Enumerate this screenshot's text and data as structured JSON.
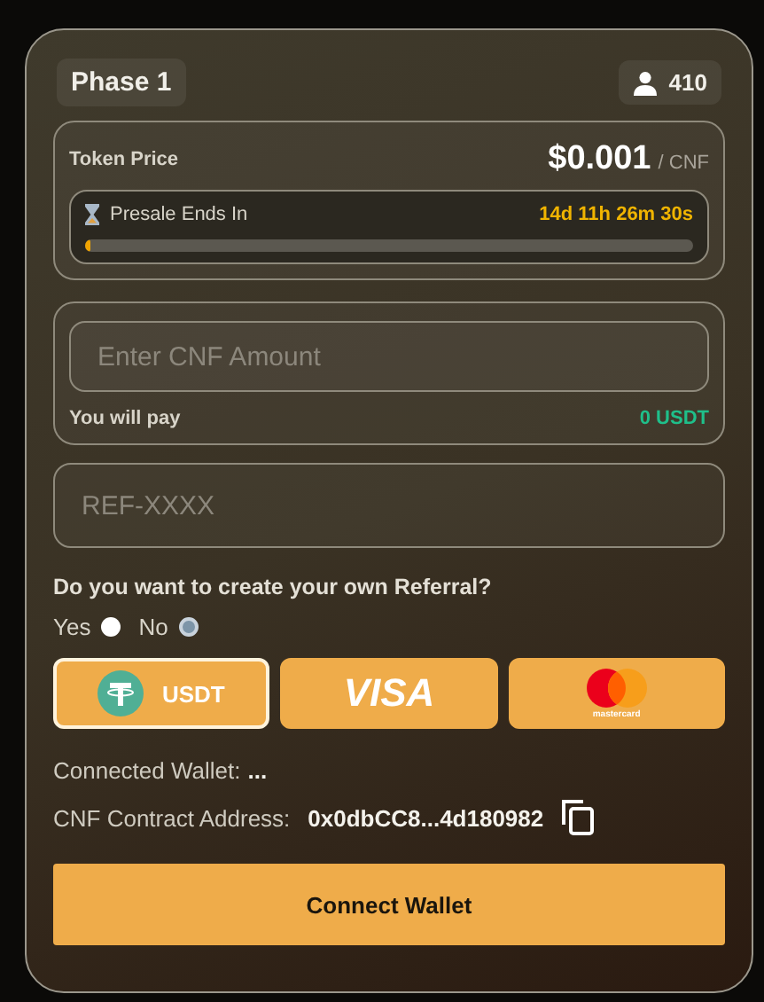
{
  "phase": "Phase 1",
  "participants": "410",
  "price": {
    "label": "Token Price",
    "value": "$0.001",
    "unit": "/ CNF"
  },
  "countdown": {
    "label": "Presale Ends In",
    "time": "14d 11h 26m 30s",
    "level": 0.01
  },
  "amount": {
    "placeholder": "Enter CNF Amount",
    "pay_label": "You will pay",
    "pay_value": "0 USDT"
  },
  "referral": {
    "placeholder": "REF-XXXX"
  },
  "question": "Do you want to create your own Referral?",
  "options": [
    {
      "label": "Yes",
      "selected": false
    },
    {
      "label": "No",
      "selected": true
    }
  ],
  "payment_methods": [
    {
      "kind": "usdt",
      "label": "USDT",
      "selected": true
    },
    {
      "kind": "visa",
      "label": "VISA",
      "selected": false
    },
    {
      "kind": "mastercard",
      "label": "mastercard",
      "selected": false
    }
  ],
  "wallet": {
    "label": "Connected Wallet:",
    "value": "..."
  },
  "contract": {
    "label": "CNF Contract Address:",
    "value": "0x0dbCC8...4d180982"
  },
  "button": "Connect Wallet"
}
